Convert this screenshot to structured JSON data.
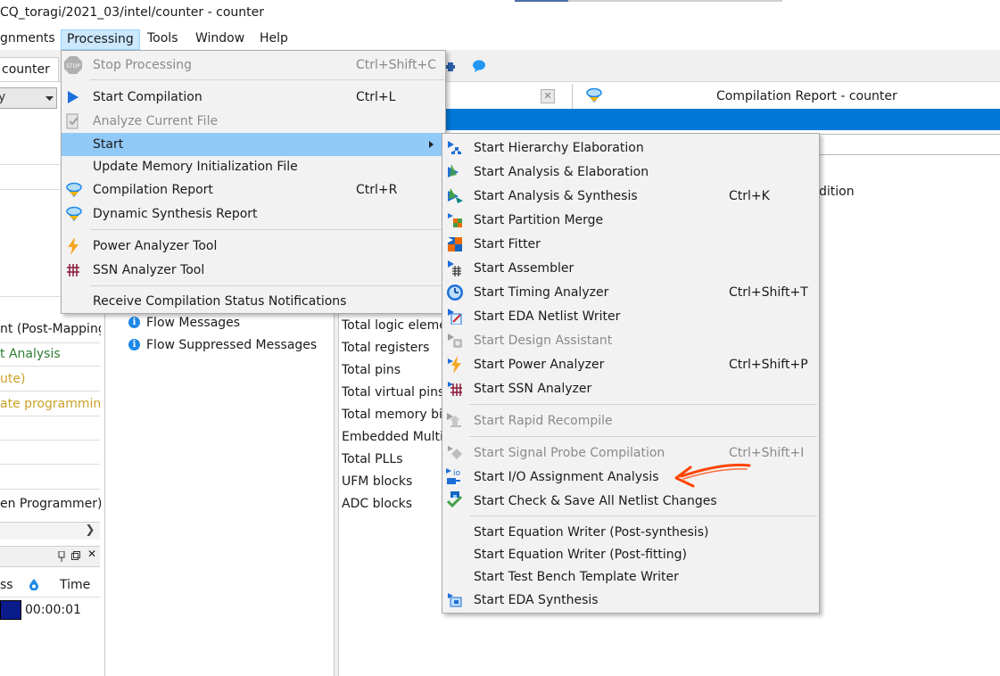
{
  "window": {
    "title": "CQ_toragi/2021_03/intel/counter - counter"
  },
  "menubar": {
    "items": [
      {
        "label": "gnments"
      },
      {
        "label": "Processing"
      },
      {
        "label": "Tools"
      },
      {
        "label": "Window"
      },
      {
        "label": "Help"
      }
    ]
  },
  "toolbar": {
    "project_tab": "counter",
    "chat_icon": "chat-bubble-icon"
  },
  "left_panel": {
    "rows": [
      "nt (Post-Mapping",
      "t Analysis",
      "ute)",
      "ate programming",
      "en Programmer)"
    ],
    "tasks_columns": [
      "ss",
      "Time"
    ],
    "tasks_time": "00:00:01"
  },
  "document_tab": {
    "title": "Compilation Report - counter"
  },
  "flow_messages": [
    "Flow Messages",
    "Flow Suppressed Messages"
  ],
  "flow_summary": {
    "rows": [
      "Total logic eleme",
      "Total registers",
      "Total pins",
      "Total virtual pins",
      "Total memory bi",
      "Embedded Multi",
      "Total PLLs",
      "UFM blocks",
      "ADC blocks"
    ],
    "partial_right_text": "dition"
  },
  "processing_menu": {
    "items": [
      {
        "label": "Stop Processing",
        "shortcut": "Ctrl+Shift+C",
        "disabled": true,
        "icon": "stop-icon"
      },
      {
        "label": "Start Compilation",
        "shortcut": "Ctrl+L",
        "icon": "play-icon"
      },
      {
        "label": "Analyze Current File",
        "disabled": true,
        "icon": "analyze-file-icon"
      },
      {
        "label": "Start",
        "submenu": true
      },
      {
        "label": "Update Memory Initialization File"
      },
      {
        "label": "Compilation Report",
        "shortcut": "Ctrl+R",
        "icon": "report-icon"
      },
      {
        "label": "Dynamic Synthesis Report",
        "icon": "report-icon"
      },
      {
        "label": "Power Analyzer Tool",
        "icon": "lightning-icon"
      },
      {
        "label": "SSN Analyzer Tool",
        "icon": "ssn-grid-icon"
      },
      {
        "label": "Receive Compilation Status Notifications"
      }
    ]
  },
  "start_submenu": {
    "items": [
      {
        "label": "Start Hierarchy Elaboration",
        "icon": "hierarchy-icon"
      },
      {
        "label": "Start Analysis & Elaboration",
        "icon": "analysis-elaboration-icon"
      },
      {
        "label": "Start Analysis & Synthesis",
        "shortcut": "Ctrl+K",
        "icon": "analysis-synthesis-icon"
      },
      {
        "label": "Start Partition Merge",
        "icon": "partition-merge-icon"
      },
      {
        "label": "Start Fitter",
        "icon": "fitter-icon"
      },
      {
        "label": "Start Assembler",
        "icon": "assembler-icon"
      },
      {
        "label": "Start Timing Analyzer",
        "shortcut": "Ctrl+Shift+T",
        "icon": "timing-analyzer-icon"
      },
      {
        "label": "Start EDA Netlist Writer",
        "icon": "eda-netlist-icon"
      },
      {
        "label": "Start Design Assistant",
        "disabled": true,
        "icon": "design-assistant-icon"
      },
      {
        "label": "Start Power Analyzer",
        "shortcut": "Ctrl+Shift+P",
        "icon": "power-analyzer-icon"
      },
      {
        "label": "Start SSN Analyzer",
        "icon": "ssn-analyzer-icon"
      },
      {
        "label": "Start Rapid Recompile",
        "disabled": true,
        "icon": "rapid-recompile-icon"
      },
      {
        "label": "Start Signal Probe Compilation",
        "shortcut": "Ctrl+Shift+I",
        "disabled": true,
        "icon": "signal-probe-icon"
      },
      {
        "label": "Start I/O Assignment Analysis",
        "icon": "io-assignment-icon"
      },
      {
        "label": "Start Check & Save All Netlist Changes",
        "icon": "check-save-icon"
      },
      {
        "label": "Start Equation Writer (Post-synthesis)"
      },
      {
        "label": "Start Equation Writer (Post-fitting)"
      },
      {
        "label": "Start Test Bench Template Writer"
      },
      {
        "label": "Start EDA Synthesis",
        "icon": "eda-synthesis-icon"
      }
    ]
  },
  "colors": {
    "selection": "#91c9f7",
    "accent_blue": "#0078d7",
    "menu_bg": "#f2f2f2",
    "annotation_arrow": "#ff4500",
    "analysis_green": "#2e7d32",
    "warning_gold": "#c9a227"
  },
  "annotation": {
    "type": "hand-drawn-arrow",
    "points_to": "Start I/O Assignment Analysis"
  }
}
